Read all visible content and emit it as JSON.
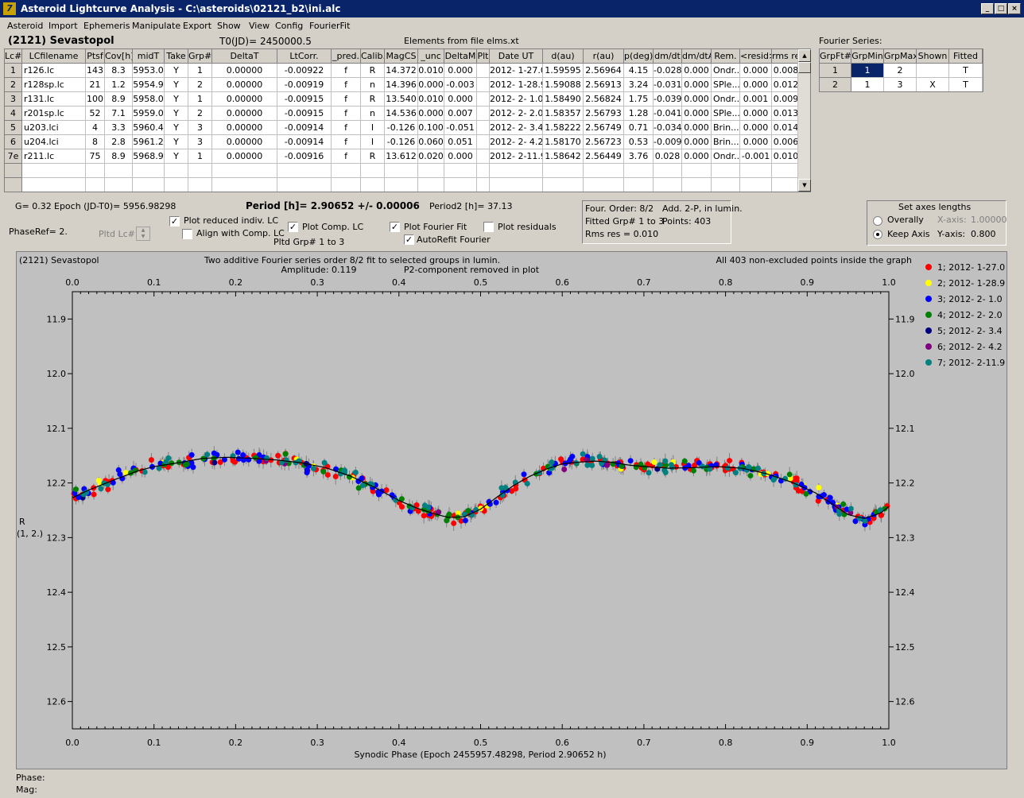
{
  "window": {
    "title": "Asteroid Lightcurve Analysis - C:\\asteroids\\02121_b2\\ini.alc",
    "minimize": "_",
    "maximize": "□",
    "close": "×"
  },
  "menu": [
    "Asteroid",
    "Import",
    "Ephemeris",
    "Manipulate",
    "Export",
    "Show",
    "View",
    "Config",
    "FourierFit"
  ],
  "info": {
    "asteroid": "(2121) Sevastopol",
    "t0": "T0(JD)= 2450000.5",
    "elements": "Elements from file elms.xt",
    "fourier_series_label": "Fourier Series:"
  },
  "lc_table": {
    "headers": [
      "Lc#",
      "LCfilename",
      "Ptsf",
      "Cov[h]",
      "midT",
      "Take",
      "Grp#",
      "DeltaT",
      "LtCorr.",
      "_pred.",
      "Calib.",
      "MagCS",
      "_unc",
      "DeltaM",
      "Plt",
      "Date UT",
      "d(au)",
      "r(au)",
      "p(deg)",
      "dm/dt",
      "dm/dtA",
      "Rem.",
      "<resid>",
      "rms res"
    ],
    "rows": [
      [
        "1",
        "r126.lc",
        "143",
        "8.3",
        "5953.0",
        "Y",
        "1",
        "0.00000",
        "-0.00922",
        "f",
        "R",
        "14.372",
        "0.010",
        "0.000",
        "",
        "2012- 1-27.0",
        "1.59595",
        "2.56964",
        "4.15",
        "-0.028",
        "0.000",
        "Ondr...",
        "0.000",
        "0.008"
      ],
      [
        "2",
        "r128sp.lc",
        "21",
        "1.2",
        "5954.9",
        "Y",
        "2",
        "0.00000",
        "-0.00919",
        "f",
        "n",
        "14.396",
        "0.000",
        "-0.003",
        "",
        "2012- 1-28.9",
        "1.59088",
        "2.56913",
        "3.24",
        "-0.031",
        "0.000",
        "SPle...",
        "0.000",
        "0.012"
      ],
      [
        "3",
        "r131.lc",
        "100",
        "8.9",
        "5958.0",
        "Y",
        "1",
        "0.00000",
        "-0.00915",
        "f",
        "R",
        "13.540",
        "0.010",
        "0.000",
        "",
        "2012- 2- 1.0",
        "1.58490",
        "2.56824",
        "1.75",
        "-0.039",
        "0.000",
        "Ondr...",
        "0.001",
        "0.009"
      ],
      [
        "4",
        "r201sp.lc",
        "52",
        "7.1",
        "5959.0",
        "Y",
        "2",
        "0.00000",
        "-0.00915",
        "f",
        "n",
        "14.536",
        "0.000",
        "0.007",
        "",
        "2012- 2- 2.0",
        "1.58357",
        "2.56793",
        "1.28",
        "-0.041",
        "0.000",
        "SPle...",
        "0.000",
        "0.013"
      ],
      [
        "5",
        "u203.lci",
        "4",
        "3.3",
        "5960.4",
        "Y",
        "3",
        "0.00000",
        "-0.00914",
        "f",
        "I",
        "-0.126",
        "0.100",
        "-0.051",
        "",
        "2012- 2- 3.4",
        "1.58222",
        "2.56749",
        "0.71",
        "-0.034",
        "0.000",
        "Brin...",
        "0.000",
        "0.014"
      ],
      [
        "6",
        "u204.lci",
        "8",
        "2.8",
        "5961.2",
        "Y",
        "3",
        "0.00000",
        "-0.00914",
        "f",
        "I",
        "-0.126",
        "0.060",
        "0.051",
        "",
        "2012- 2- 4.2",
        "1.58170",
        "2.56723",
        "0.53",
        "-0.009",
        "0.000",
        "Brin...",
        "0.000",
        "0.006"
      ],
      [
        "7e",
        "r211.lc",
        "75",
        "8.9",
        "5968.9",
        "Y",
        "1",
        "0.00000",
        "-0.00916",
        "f",
        "R",
        "13.612",
        "0.020",
        "0.000",
        "",
        "2012- 2-11.9",
        "1.58642",
        "2.56449",
        "3.76",
        "0.028",
        "0.000",
        "Ondr...",
        "-0.001",
        "0.010"
      ]
    ]
  },
  "fourier_table": {
    "headers": [
      "GrpFt#",
      "GrpMin",
      "GrpMax",
      "Shown",
      "Fitted"
    ],
    "rows": [
      [
        "1",
        "1",
        "2",
        "",
        "T"
      ],
      [
        "2",
        "1",
        "3",
        "X",
        "T"
      ]
    ]
  },
  "params": {
    "g": "G= 0.32",
    "epoch": "Epoch (JD-T0)= 5956.98298",
    "period": "Period [h]= 2.90652 +/- 0.00006",
    "period2": "Period2 [h]= 37.13",
    "phaseref": "PhaseRef= 2.",
    "pltd_lc": "Pltd Lc#:",
    "pltd_grp": "Pltd Grp#  1   to   3"
  },
  "checkboxes": {
    "plot_reduced": {
      "label": "Plot reduced indiv. LC",
      "checked": true
    },
    "align_comp": {
      "label": "Align with Comp. LC",
      "checked": false
    },
    "plot_comp": {
      "label": "Plot Comp. LC",
      "checked": true
    },
    "plot_fourier": {
      "label": "Plot Fourier Fit",
      "checked": true
    },
    "autorefit": {
      "label": "AutoRefit Fourier",
      "checked": true
    },
    "plot_resid": {
      "label": "Plot residuals",
      "checked": false
    }
  },
  "fit_info": {
    "order": "Four. Order:  8/2",
    "add": "Add. 2-P, in lumin.",
    "fitted": "Fitted Grp# 1 to 3",
    "points": "Points: 403",
    "rms": "Rms res    = 0.010"
  },
  "axes_box": {
    "title": "Set axes lengths",
    "overally": "Overally",
    "keep_axis": "Keep Axis",
    "xaxis_label": "X-axis:",
    "xaxis_value": "1.00000",
    "yaxis_label": "Y-axis:",
    "yaxis_value": "0.800",
    "selected": "keep_axis"
  },
  "status": {
    "phase": "Phase:",
    "mag": "Mag:"
  },
  "chart_data": {
    "type": "scatter",
    "title_left": "(2121) Sevastopol",
    "title_center1": "Two additive Fourier series order 8/2 fit to selected groups in lumin.",
    "title_center2_a": "Amplitude: 0.119",
    "title_center2_b": "P2-component removed in plot",
    "title_right": "All 403 non-excluded points inside the graph",
    "xlabel": "Synodic Phase (Epoch 2455957.48298, Period 2.90652 h)",
    "ylabel": "R",
    "ylabel2": "(1, 2.)",
    "xlim": [
      0,
      1
    ],
    "ylim": [
      11.85,
      12.65
    ],
    "y_reversed": true,
    "xticks": [
      "0.0",
      "0.1",
      "0.2",
      "0.3",
      "0.4",
      "0.5",
      "0.6",
      "0.7",
      "0.8",
      "0.9",
      "1.0"
    ],
    "yticks": [
      "11.9",
      "12.0",
      "12.1",
      "12.2",
      "12.3",
      "12.4",
      "12.5",
      "12.6"
    ],
    "ytick_values": [
      11.9,
      12.0,
      12.1,
      12.2,
      12.3,
      12.4,
      12.5,
      12.6
    ],
    "fit_curve": [
      [
        0.0,
        12.227
      ],
      [
        0.02,
        12.213
      ],
      [
        0.05,
        12.195
      ],
      [
        0.08,
        12.178
      ],
      [
        0.1,
        12.17
      ],
      [
        0.13,
        12.163
      ],
      [
        0.16,
        12.155
      ],
      [
        0.19,
        12.153
      ],
      [
        0.22,
        12.155
      ],
      [
        0.25,
        12.158
      ],
      [
        0.28,
        12.163
      ],
      [
        0.31,
        12.172
      ],
      [
        0.34,
        12.187
      ],
      [
        0.37,
        12.208
      ],
      [
        0.4,
        12.232
      ],
      [
        0.42,
        12.245
      ],
      [
        0.44,
        12.255
      ],
      [
        0.46,
        12.263
      ],
      [
        0.48,
        12.262
      ],
      [
        0.5,
        12.248
      ],
      [
        0.52,
        12.226
      ],
      [
        0.54,
        12.205
      ],
      [
        0.56,
        12.188
      ],
      [
        0.58,
        12.175
      ],
      [
        0.6,
        12.165
      ],
      [
        0.62,
        12.162
      ],
      [
        0.64,
        12.16
      ],
      [
        0.66,
        12.162
      ],
      [
        0.68,
        12.167
      ],
      [
        0.7,
        12.17
      ],
      [
        0.73,
        12.173
      ],
      [
        0.76,
        12.172
      ],
      [
        0.79,
        12.17
      ],
      [
        0.82,
        12.173
      ],
      [
        0.85,
        12.183
      ],
      [
        0.88,
        12.198
      ],
      [
        0.91,
        12.218
      ],
      [
        0.93,
        12.238
      ],
      [
        0.95,
        12.258
      ],
      [
        0.97,
        12.265
      ],
      [
        0.99,
        12.255
      ],
      [
        1.0,
        12.243
      ]
    ],
    "series": [
      {
        "name": "1; 2012- 1-27.0",
        "color": "#ff0000",
        "count": 143
      },
      {
        "name": "2; 2012- 1-28.9",
        "color": "#ffff00",
        "count": 21
      },
      {
        "name": "3; 2012- 2- 1.0",
        "color": "#0000ff",
        "count": 100
      },
      {
        "name": "4; 2012- 2- 2.0",
        "color": "#008000",
        "count": 52
      },
      {
        "name": "5; 2012- 2- 3.4",
        "color": "#000080",
        "count": 4
      },
      {
        "name": "6; 2012- 2- 4.2",
        "color": "#800080",
        "count": 8
      },
      {
        "name": "7; 2012- 2-11.9",
        "color": "#008080",
        "count": 75
      }
    ]
  }
}
